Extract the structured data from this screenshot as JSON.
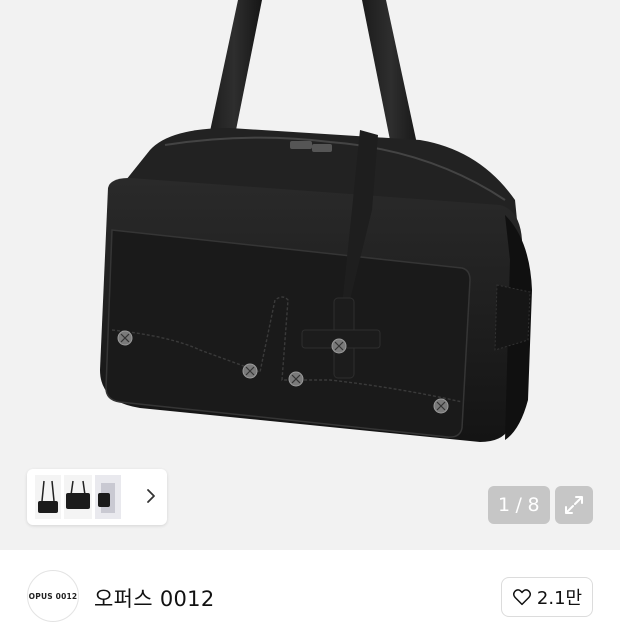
{
  "viewer": {
    "image_alt": "black leather bowling bag",
    "counter_current": "1",
    "counter_separator": "/",
    "counter_total": "8",
    "thumbnails": [
      {
        "icon": "bag-shoulder-thumbnail"
      },
      {
        "icon": "bag-front-thumbnail"
      },
      {
        "icon": "bag-model-thumbnail"
      }
    ],
    "next_icon": "chevron-right-icon",
    "expand_icon": "expand-icon"
  },
  "brand": {
    "logo_text": "OPUS 0012",
    "name": "오퍼스 0012",
    "like_icon": "heart-icon",
    "like_count": "2.1만"
  },
  "colors": {
    "background": "#f2f2f2",
    "overlay_button": "#c6c6c6",
    "bag": "#1a1a1a"
  }
}
